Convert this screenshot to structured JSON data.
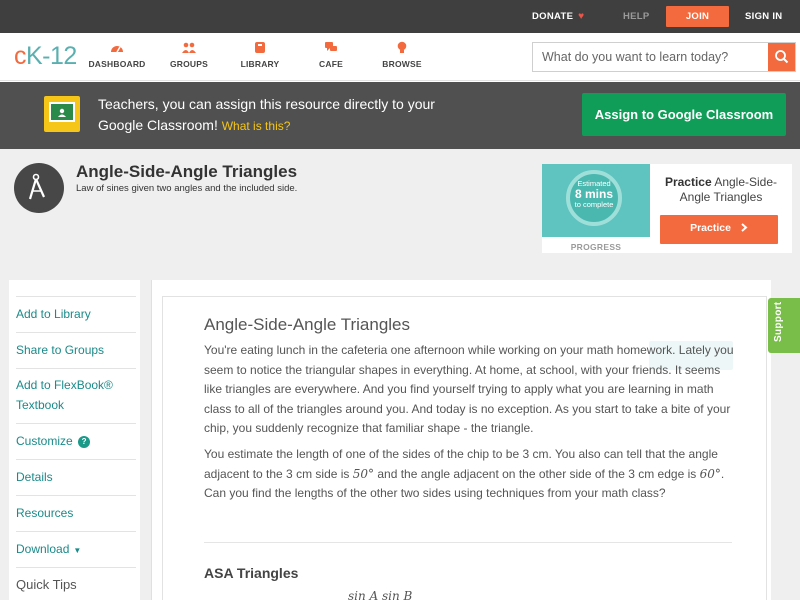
{
  "topbar": {
    "donate": "DONATE",
    "help": "HELP",
    "join": "JOIN",
    "signin": "SIGN IN"
  },
  "logo": {
    "c": "c",
    "k": "K-12"
  },
  "nav": [
    {
      "label": "DASHBOARD",
      "icon": "dashboard-icon"
    },
    {
      "label": "GROUPS",
      "icon": "groups-icon"
    },
    {
      "label": "LIBRARY",
      "icon": "library-icon"
    },
    {
      "label": "CAFE",
      "icon": "cafe-icon"
    },
    {
      "label": "BROWSE",
      "icon": "browse-icon"
    }
  ],
  "search": {
    "placeholder": "What do you want to learn today?"
  },
  "banner": {
    "text": "Teachers, you can assign this resource directly to your Google Classroom!",
    "what_is": "What is this?",
    "assign": "Assign to Google Classroom"
  },
  "header": {
    "title": "Angle-Side-Angle Triangles",
    "subtitle": "Law of sines given two angles and the included side."
  },
  "practice_card": {
    "estimated": "Estimated",
    "minutes": "8 mins",
    "to_complete": "to complete",
    "progress": "PROGRESS",
    "practice_word": "Practice",
    "title_rest": "Angle-Side-Angle Triangles",
    "button": "Practice"
  },
  "sidebar": {
    "items": [
      "Add to Library",
      "Share to Groups",
      "Add to FlexBook® Textbook",
      "Customize",
      "Details",
      "Resources",
      "Download"
    ],
    "quick_tips": "Quick Tips"
  },
  "article": {
    "title": "Angle-Side-Angle Triangles",
    "p1": "You're eating lunch in the cafeteria one afternoon while working on your math homework. Lately you seem to notice the triangular shapes in everything. At home, at school, with your friends. It seems like triangles are everywhere. And you find yourself trying to apply what you are learning in math class to all of the triangles around you. And today is no exception. As you start to take a bite of your chip, you suddenly recognize that familiar shape - the triangle.",
    "p2_a": "You estimate the length of one of the sides of the chip to be 3 cm. You also can tell that the angle adjacent to the 3 cm side is ",
    "angle1": "50°",
    "p2_b": " and the angle adjacent on the other side of the 3 cm edge is ",
    "angle2": "60°",
    "p2_c": ". Can you find the lengths of the other two sides using techniques from your math class?",
    "h2": "ASA Triangles",
    "math_fragment": "sin A    sin B"
  },
  "support": "Support",
  "colors": {
    "brand_orange": "#f26a3d",
    "brand_teal": "#5ab0b1",
    "google_green": "#0f9d58",
    "support_green": "#79be48"
  }
}
